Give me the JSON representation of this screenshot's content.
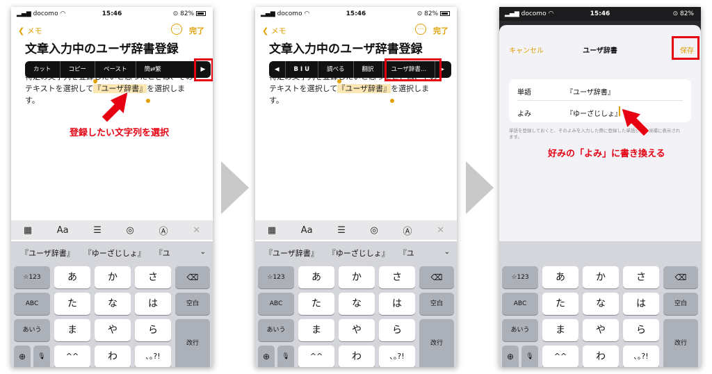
{
  "status": {
    "carrier": "docomo",
    "time": "15:46",
    "battery": "82%"
  },
  "notes": {
    "back_label": "メモ",
    "more_label": "…",
    "done_label": "完了",
    "title": "文章入力中のユーザ辞書登録",
    "body_before": "特定の文字列を登録したいと思ったときは、そのテキストを選択して",
    "body_selected": "『ユーザ辞書』",
    "body_after": "を選択します。"
  },
  "menu1": {
    "items": [
      "カット",
      "コピー",
      "ペースト",
      "簡⇄繁"
    ],
    "next": "▶"
  },
  "menu2": {
    "prev": "◀",
    "items": [
      "B I U",
      "調べる",
      "翻訳",
      "ユーザ辞書…"
    ],
    "next": "▶"
  },
  "annotations": {
    "step1": "登録したい文字列を選択",
    "step3": "好みの「よみ」に書き換える"
  },
  "toolbar": {
    "table": "▦",
    "format": "Aa",
    "checklist": "☰",
    "camera": "◎",
    "markup": "Ⓐ",
    "close": "✕"
  },
  "suggestions": {
    "s1": "『ユーザ辞書』",
    "s2": "『ゆーざじしょ』",
    "s3": "『ユ",
    "chevron": "⌄"
  },
  "keyboard": {
    "num": "☆123",
    "abc": "ABC",
    "kana": "あいう",
    "globe": "⊕",
    "mic": "🎙",
    "delete": "⌫",
    "space": "空白",
    "enter": "改行",
    "row1": [
      "あ",
      "か",
      "さ"
    ],
    "row2": [
      "た",
      "な",
      "は"
    ],
    "row3": [
      "ま",
      "や",
      "ら"
    ],
    "row4": [
      "^^",
      "わ",
      "､｡?!"
    ]
  },
  "dict": {
    "cancel": "キャンセル",
    "title": "ユーザ辞書",
    "save": "保存",
    "word_label": "単語",
    "word_value": "『ユーザ辞書』",
    "yomi_label": "よみ",
    "yomi_value": "『ゆーざじしょ』",
    "note": "単語を登録しておくと、そのよみを入力した際に登録した単語が変換候補に表示されます。"
  },
  "colors": {
    "accent": "#e0a000",
    "annotation": "#e60012",
    "keyboard_bg": "#d4d6db"
  }
}
